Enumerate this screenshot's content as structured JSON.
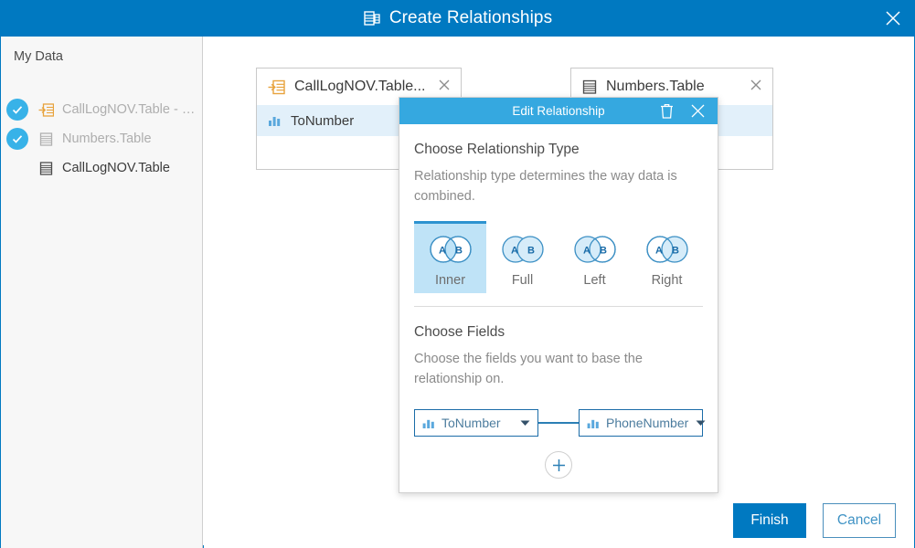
{
  "window": {
    "title": "Create Relationships",
    "title_icon": "tables-icon",
    "close_icon": "close-icon",
    "accent_color": "#0079c1"
  },
  "sidebar": {
    "heading": "My Data",
    "items": [
      {
        "label": "CallLogNOV.Table - Nu...",
        "icon": "join-table-icon",
        "checked": true,
        "dimmed": true
      },
      {
        "label": "Numbers.Table",
        "icon": "table-icon",
        "checked": true,
        "dimmed": true
      },
      {
        "label": "CallLogNOV.Table",
        "icon": "table-icon",
        "checked": false,
        "dimmed": false
      }
    ]
  },
  "canvas": {
    "cards": [
      {
        "title": "CallLogNOV.Table...",
        "icon": "join-table-icon",
        "close_icon": "close-icon",
        "fields": [
          {
            "label": "ToNumber",
            "icon": "numeric-field-icon",
            "selected": true
          }
        ]
      },
      {
        "title": "Numbers.Table",
        "icon": "table-icon",
        "close_icon": "close-icon",
        "fields": [
          {
            "label": "",
            "icon": "",
            "selected": true
          }
        ]
      }
    ]
  },
  "dialog": {
    "title": "Edit Relationship",
    "header_color": "#35a8e0",
    "delete_icon": "trash-icon",
    "close_icon": "close-icon",
    "relationship_type": {
      "heading": "Choose Relationship Type",
      "description": "Relationship type determines the way data is combined.",
      "selected": "Inner",
      "options": [
        {
          "label": "Inner",
          "venn": "inner",
          "a": "A",
          "b": "B"
        },
        {
          "label": "Full",
          "venn": "full",
          "a": "A",
          "b": "B"
        },
        {
          "label": "Left",
          "venn": "left",
          "a": "A",
          "b": "B"
        },
        {
          "label": "Right",
          "venn": "right",
          "a": "A",
          "b": "B"
        }
      ]
    },
    "fields_section": {
      "heading": "Choose Fields",
      "description": "Choose the fields you want to base the relationship on.",
      "left_field": {
        "label": "ToNumber",
        "icon": "numeric-field-icon",
        "caret": "chevron-down-icon"
      },
      "right_field": {
        "label": "PhoneNumber",
        "icon": "numeric-field-icon",
        "caret": "chevron-down-icon"
      },
      "add_icon": "plus-icon"
    }
  },
  "footer": {
    "finish_label": "Finish",
    "cancel_label": "Cancel"
  }
}
